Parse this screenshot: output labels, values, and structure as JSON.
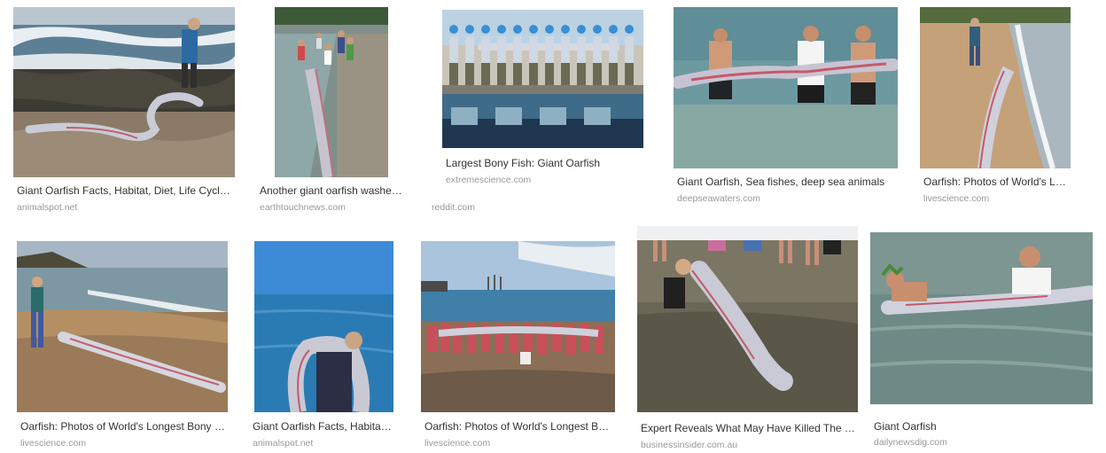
{
  "results": [
    {
      "title": "Giant Oarfish Facts, Habitat, Diet, Life Cycle, Baby, Pictures",
      "source": "animalspot.net",
      "image_subject": "oarfish-on-rocky-shore-photo"
    },
    {
      "title": "Another giant oarfish washes ashore",
      "source": "earthtouchnews.com",
      "image_subject": "oarfish-in-shallow-water-photo"
    },
    {
      "title": "Largest Bony Fish: Giant Oarfish",
      "source": "extremescience.com",
      "image_subject": "people-holding-oarfish-on-dock-photo"
    },
    {
      "title": "",
      "source": "reddit.com",
      "image_subject": ""
    },
    {
      "title": "Giant Oarfish, Sea fishes, deep sea animals",
      "source": "deepseawaters.com",
      "image_subject": "men-holding-oarfish-in-water-photo"
    },
    {
      "title": "Oarfish: Photos of World's Longest Bony Fish",
      "source": "livescience.com",
      "image_subject": "oarfish-on-beach-photo"
    },
    {
      "title": "Oarfish: Photos of World's Longest Bony Fish",
      "source": "livescience.com",
      "image_subject": "woman-and-oarfish-on-beach-photo"
    },
    {
      "title": "Giant Oarfish Facts, Habitat, Diet, Life Cycle",
      "source": "animalspot.net",
      "image_subject": "man-carrying-oarfish-photo"
    },
    {
      "title": "Oarfish: Photos of World's Longest Bony Fish",
      "source": "livescience.com",
      "image_subject": "group-holding-oarfish-photo"
    },
    {
      "title": "Expert Reveals What May Have Killed The Giant Oarfish",
      "source": "businessinsider.com.au",
      "image_subject": "people-around-oarfish-in-shallows-photo"
    },
    {
      "title": "Giant Oarfish",
      "source": "dailynewsdig.com",
      "image_subject": "people-with-oarfish-swimming-photo"
    }
  ]
}
